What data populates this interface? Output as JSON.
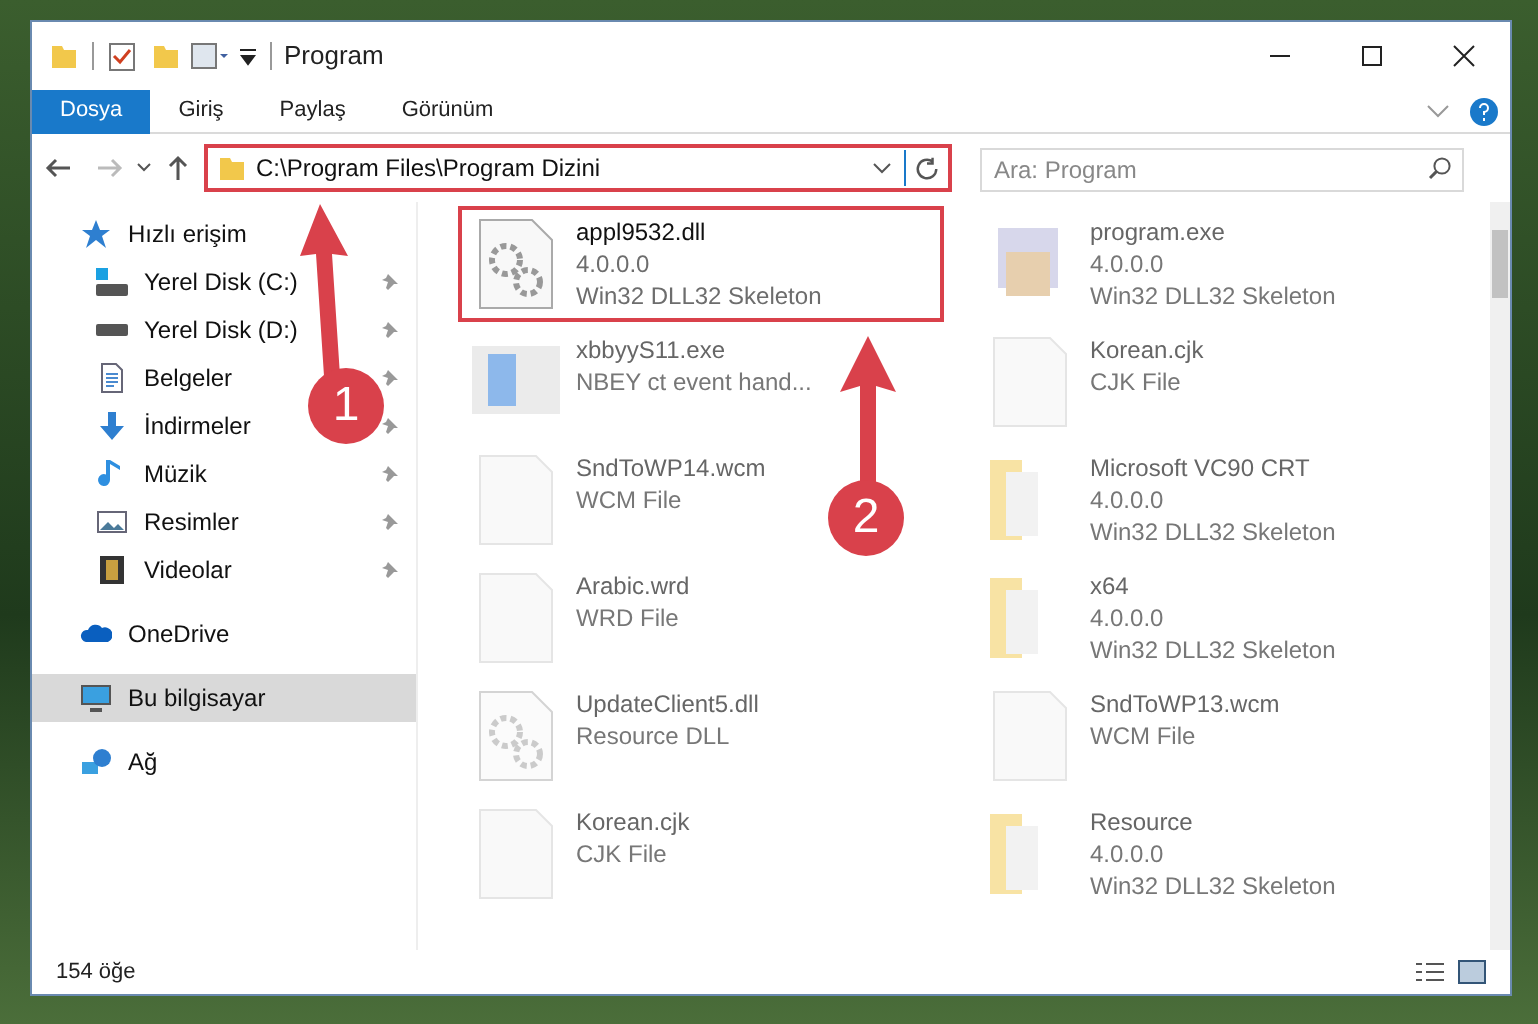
{
  "window": {
    "title": "Program"
  },
  "ribbon_tabs": [
    {
      "label": "Dosya",
      "selected": true
    },
    {
      "label": "Giriş",
      "selected": false
    },
    {
      "label": "Paylaş",
      "selected": false
    },
    {
      "label": "Görünüm",
      "selected": false
    }
  ],
  "address_bar": {
    "path": "C:\\Program Files\\Program Dizini"
  },
  "search": {
    "placeholder": "Ara: Program"
  },
  "sidebar": {
    "items": [
      {
        "label": "Hızlı erişim",
        "kind": "star",
        "selected": false,
        "pinned": false,
        "children": [
          {
            "label": "Yerel Disk (C:)",
            "kind": "drive-win",
            "selected": false,
            "pinned": true
          },
          {
            "label": "Yerel Disk (D:)",
            "kind": "drive",
            "selected": false,
            "pinned": true
          },
          {
            "label": "Belgeler",
            "kind": "doc",
            "selected": false,
            "pinned": true
          },
          {
            "label": "İndirmeler",
            "kind": "download",
            "selected": false,
            "pinned": true
          },
          {
            "label": "Müzik",
            "kind": "music",
            "selected": false,
            "pinned": true
          },
          {
            "label": "Resimler",
            "kind": "picture",
            "selected": false,
            "pinned": true
          },
          {
            "label": "Videolar",
            "kind": "video",
            "selected": false,
            "pinned": true
          }
        ]
      },
      {
        "label": "OneDrive",
        "kind": "cloud",
        "selected": false,
        "pinned": false
      },
      {
        "label": "Bu bilgisayar",
        "kind": "computer",
        "selected": true,
        "pinned": false
      },
      {
        "label": "Ağ",
        "kind": "network",
        "selected": false,
        "pinned": false
      }
    ]
  },
  "files": [
    {
      "name": "appl9532.dll",
      "lines": [
        "4.0.0.0",
        "Win32 DLL32 Skeleton"
      ],
      "kind": "gear",
      "blurred": false
    },
    {
      "name": "program.exe",
      "lines": [
        "4.0.0.0",
        "Win32 DLL32 Skeleton"
      ],
      "kind": "app",
      "blurred": true
    },
    {
      "name": "xbbyyS11.exe",
      "lines": [
        "NBEY ct event hand..."
      ],
      "kind": "blue",
      "blurred": true
    },
    {
      "name": "Korean.cjk",
      "lines": [
        "CJK File"
      ],
      "kind": "blank",
      "blurred": true
    },
    {
      "name": "SndToWP14.wcm",
      "lines": [
        "WCM File"
      ],
      "kind": "blank",
      "blurred": true
    },
    {
      "name": "Microsoft VC90 CRT",
      "lines": [
        "4.0.0.0",
        "Win32 DLL32 Skeleton"
      ],
      "kind": "folder",
      "blurred": true
    },
    {
      "name": "Arabic.wrd",
      "lines": [
        "WRD File"
      ],
      "kind": "blank",
      "blurred": true
    },
    {
      "name": "x64",
      "lines": [
        "4.0.0.0",
        "Win32 DLL32 Skeleton"
      ],
      "kind": "folder",
      "blurred": true
    },
    {
      "name": "UpdateClient5.dll",
      "lines": [
        "Resource DLL"
      ],
      "kind": "gear",
      "blurred": true
    },
    {
      "name": "SndToWP13.wcm",
      "lines": [
        "WCM File"
      ],
      "kind": "blank",
      "blurred": true
    },
    {
      "name": "Korean.cjk",
      "lines": [
        "CJK File"
      ],
      "kind": "blank",
      "blurred": true
    },
    {
      "name": "Resource",
      "lines": [
        "4.0.0.0",
        "Win32 DLL32 Skeleton"
      ],
      "kind": "folder",
      "blurred": true
    }
  ],
  "status_bar": {
    "count": "154 öğe"
  },
  "annotations": [
    {
      "number": "1"
    },
    {
      "number": "2"
    }
  ]
}
